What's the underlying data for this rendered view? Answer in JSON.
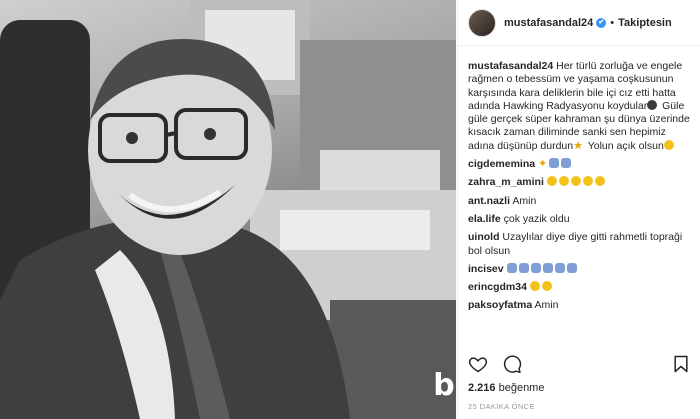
{
  "post": {
    "username": "mustafasandal24",
    "verified_mark": "✔",
    "separator": "•",
    "follow_status": "Takiptesin"
  },
  "caption": {
    "user": "mustafasandal24",
    "text_1": "Her türlü zorluğa ve engele rağmen o tebessüm ve yaşama coşkusunun karşısında kara deliklerin bile içi cız etti hatta adında Hawking Radyasyonu koydular",
    "text_2": " Güle güle gerçek süper kahraman şu dünya üzerinde kısacık zaman diliminde sanki sen hepimiz adına düşünüp durdun",
    "text_3": " Yolun açık olsun"
  },
  "comments": [
    {
      "user": "cigdememina",
      "text": ""
    },
    {
      "user": "zahra_m_amini",
      "text": ""
    },
    {
      "user": "ant.nazli",
      "text": "Amin"
    },
    {
      "user": "ela.life",
      "text": "çok yazik oldu"
    },
    {
      "user": "uinold",
      "text": "Uzaylılar diye diye gitti rahmetli topraği bol olsun"
    },
    {
      "user": "incisev",
      "text": ""
    },
    {
      "user": "erincgdm34",
      "text": ""
    },
    {
      "user": "paksoyfatma",
      "text": "Amin"
    }
  ],
  "likes": {
    "count": "2.216",
    "label": "beğenme"
  },
  "timestamp": "25 DAKİKA ÖNCE",
  "watermark": "b",
  "icons": [
    "heart-icon",
    "comment-icon",
    "bookmark-icon",
    "verified-icon"
  ],
  "colors": {
    "verified": "#3897f0",
    "text": "#262626",
    "muted": "#999999"
  }
}
